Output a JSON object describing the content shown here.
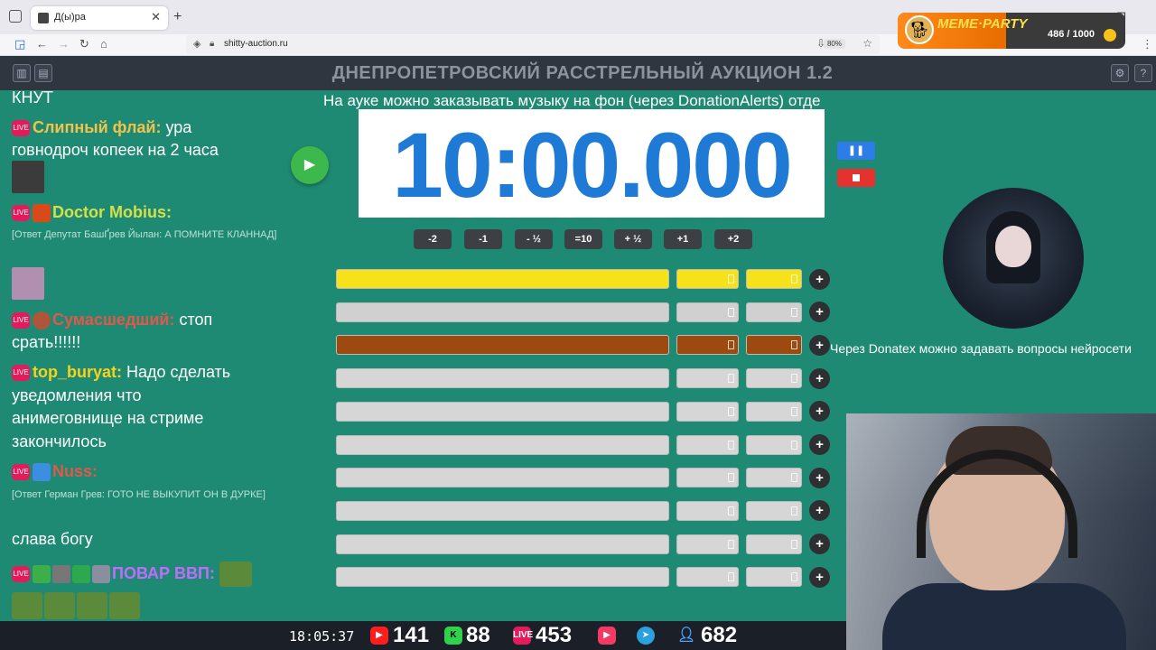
{
  "browser": {
    "tab_title": "Д(ы)ра",
    "url": "shitty-auction.ru",
    "zoom": "80%"
  },
  "meme_party": {
    "name": "MEME·PARTY",
    "score": "486 / 1000"
  },
  "site": {
    "title": "ДНЕПРОПЕТРОВСКИЙ РАССТРЕЛЬНЫЙ АУКЦИОН 1.2"
  },
  "chat": {
    "top_text": "КНУТ",
    "messages": [
      {
        "nick": "Слипный флай:",
        "text": " ура",
        "cont": "говнодроч копеек на 2 часа",
        "nick_color": "#f0c34a"
      },
      {
        "nick": "Doctor Mobius:",
        "reply": "[Ответ Депутат БашҐрев Йылан: А ПОМНИТЕ КЛАННАД]",
        "nick_color": "#d4e04a"
      },
      {
        "nick": "Сумасшедший:",
        "text": " стоп",
        "cont": "срать!!!!!!",
        "nick_color": "#e0584a"
      },
      {
        "nick": "top_buryat:",
        "text": " Надо сделать",
        "cont": "уведомления что",
        "cont2": "анимеговнище на стриме",
        "cont3": "закончилось",
        "nick_color": "#f7d21c"
      },
      {
        "nick": "Nuss:",
        "reply": "[Ответ Герман Грев: ГОТО НЕ ВЫКУПИТ ОН В ДУРКЕ]",
        "text2": "слава богу",
        "nick_color": "#e0584a"
      },
      {
        "nick": "ПОВАР ВВП:",
        "nick_color": "#c06cff"
      }
    ]
  },
  "auction": {
    "notice": "На ауке можно заказывать музыку на фон (через DonationAlerts) отде",
    "timer": "10:00.000",
    "pause_label": "❚❚",
    "adjust_buttons": [
      "-2",
      "-1",
      "- ½",
      "=10",
      "+ ½",
      "+1",
      "+2"
    ],
    "plus_label": "+",
    "lot_colors": [
      "#f5e21a",
      "#d0d0d0",
      "#9c4a10",
      "#d6d6d6",
      "#d6d6d6",
      "#d6d6d6",
      "#d6d6d6",
      "#d6d6d6",
      "#d6d6d6",
      "#d6d6d6"
    ]
  },
  "right": {
    "donatex_text": "Через Donatex можно задавать вопросы нейросети"
  },
  "stats": {
    "clock": "18:05:37",
    "youtube": "141",
    "kick": "88",
    "vk_live": "453",
    "telegram": "",
    "viewers": "682"
  }
}
